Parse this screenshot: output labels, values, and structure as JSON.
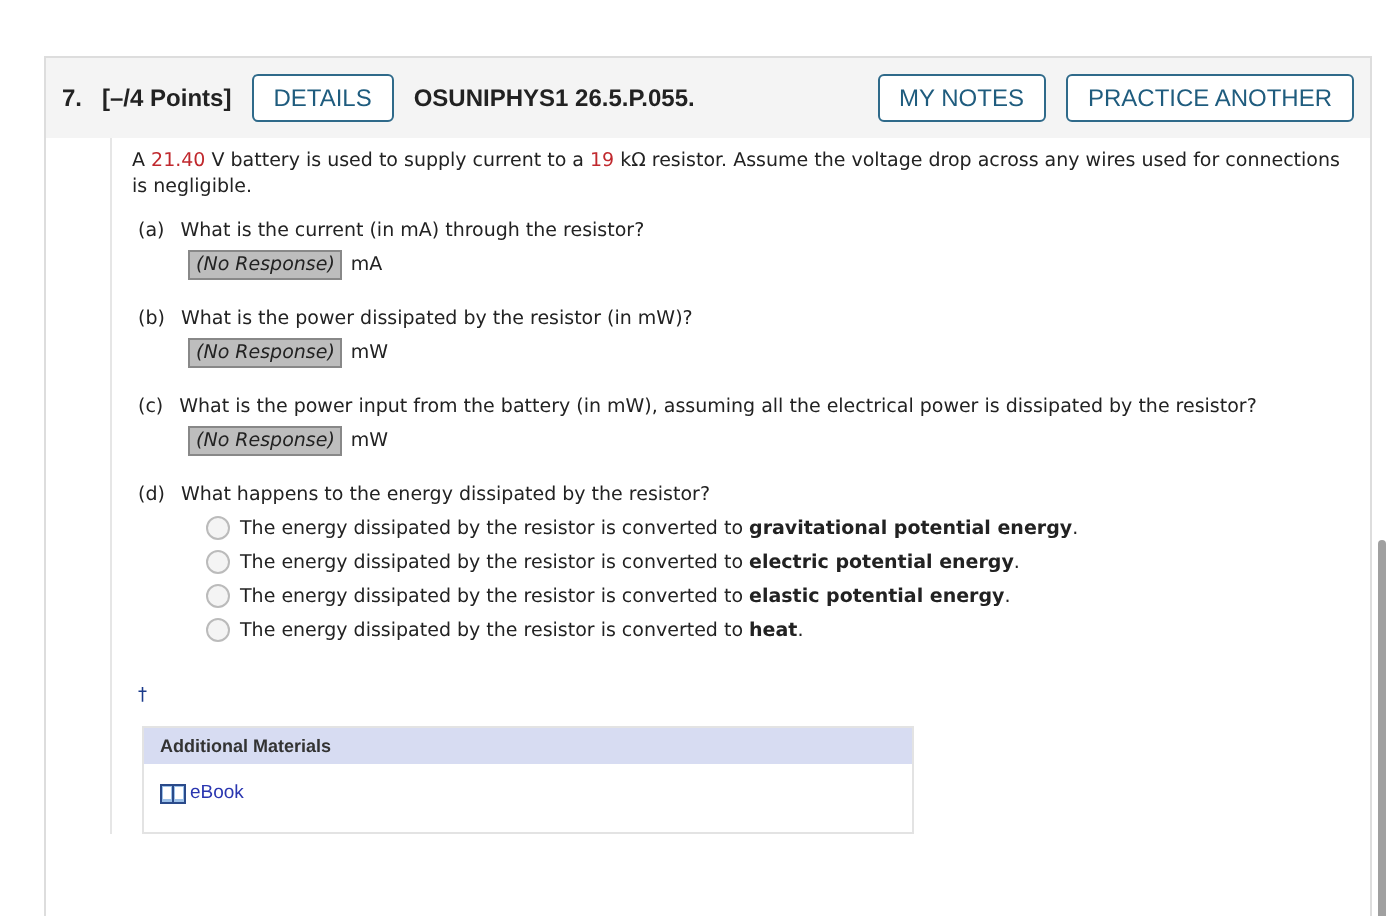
{
  "header": {
    "number": "7.",
    "points": "[–/4 Points]",
    "details_button": "DETAILS",
    "problem_id": "OSUNIPHYS1 26.5.P.055.",
    "buttons": [
      "MY NOTES",
      "PRACTICE ANOTHER"
    ]
  },
  "prompt": [
    {
      "text": "A ",
      "highlight": false
    },
    {
      "text": "21.40",
      "highlight": true
    },
    {
      "text": " V battery is used to supply current to a ",
      "highlight": false
    },
    {
      "text": "19",
      "highlight": true
    },
    {
      "text": " kΩ resistor. Assume the voltage drop across any wires used for connections is negligible.",
      "highlight": false
    }
  ],
  "parts": [
    {
      "kind": "numeric",
      "label": "(a)",
      "question": "What is the current (in mA) through the resistor?",
      "response": "(No Response)",
      "unit": "mA"
    },
    {
      "kind": "numeric",
      "label": "(b)",
      "question": "What is the power dissipated by the resistor (in mW)?",
      "response": "(No Response)",
      "unit": "mW"
    },
    {
      "kind": "numeric",
      "label": "(c)",
      "question": "What is the power input from the battery (in mW), assuming all the electrical power is dissipated by the resistor?",
      "response": "(No Response)",
      "unit": "mW"
    },
    {
      "kind": "choice",
      "label": "(d)",
      "question": "What happens to the energy dissipated by the resistor?",
      "options": [
        {
          "text": "The energy dissipated by the resistor is converted to **gravitational potential energy**.",
          "selected": false
        },
        {
          "text": "The energy dissipated by the resistor is converted to **electric potential energy**.",
          "selected": false
        },
        {
          "text": "The energy dissipated by the resistor is converted to **elastic potential energy**.",
          "selected": false
        },
        {
          "text": "The energy dissipated by the resistor is converted to **heat**.",
          "selected": false
        }
      ]
    }
  ],
  "footnote_mark": "†",
  "additional_materials": {
    "title": "Additional Materials",
    "links": [
      "eBook"
    ]
  }
}
